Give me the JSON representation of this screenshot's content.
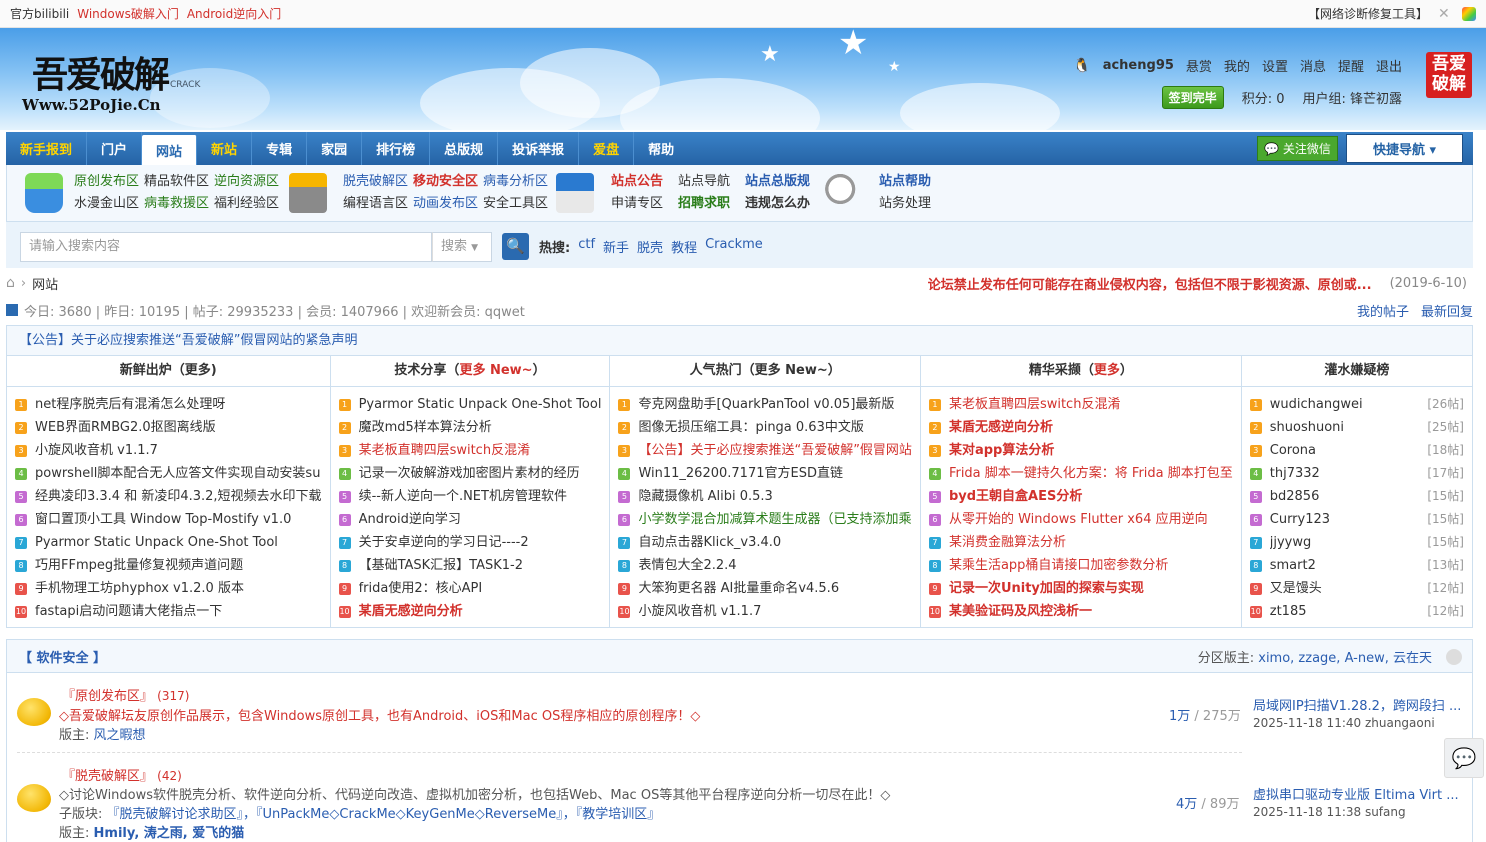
{
  "topbar": {
    "links": [
      "官方bilibili",
      "Windows破解入门",
      "Android逆向入门"
    ],
    "diag": "【网络诊断修复工具】"
  },
  "logo": {
    "big": "吾爱破解",
    "url": "Www.52PoJie.Cn",
    "crack": "CRACK"
  },
  "user": {
    "name": "acheng95",
    "menu": [
      "悬赏",
      "我的",
      "设置",
      "消息",
      "提醒",
      "退出"
    ],
    "checkin": "签到完毕",
    "points": "积分: 0",
    "group": "用户组: 锋芒初露",
    "badge": "吾爱破解"
  },
  "nav": {
    "items": [
      "新手报到",
      "门户",
      "网站",
      "新站",
      "专辑",
      "家园",
      "排行榜",
      "总版规",
      "投诉举报",
      "爱盘",
      "帮助"
    ],
    "wechat": "关注微信",
    "quick": "快捷导航 ▾"
  },
  "subnav": {
    "g1r1": [
      "原创发布区",
      "精品软件区",
      "逆向资源区"
    ],
    "g1r2": [
      "水漫金山区",
      "病毒救援区",
      "福利经验区"
    ],
    "g2r1": [
      "脱壳破解区",
      "移动安全区",
      "病毒分析区"
    ],
    "g2r2": [
      "编程语言区",
      "动画发布区",
      "安全工具区"
    ],
    "g3r1": [
      "站点公告",
      "站点导航",
      "站点总版规"
    ],
    "g3r2": [
      "申请专区",
      "招聘求职",
      "违规怎么办"
    ],
    "g4r1": [
      "站点帮助"
    ],
    "g4r2": [
      "站务处理"
    ]
  },
  "search": {
    "placeholder": "请输入搜索内容",
    "select": "搜索",
    "hot_label": "热搜:",
    "hot": [
      "ctf",
      "新手",
      "脱壳",
      "教程",
      "Crackme"
    ]
  },
  "crumb": {
    "here": "网站",
    "notice": "论坛禁止发布任何可能存在商业侵权内容，包括但不限于影视资源、原创或...",
    "date": "(2019-6-10)"
  },
  "stats": {
    "text": "今日: 3680 | 昨日: 10195 | 帖子: 29935233 | 会员: 1407966 | 欢迎新会员: qqwet",
    "links": [
      "我的帖子",
      "最新回复"
    ]
  },
  "announcement": "【公告】关于必应搜索推送“吾爱破解”假冒网站的紧急声明",
  "columns": [
    {
      "head": "新鲜出炉（更多)",
      "items": [
        "net程序脱壳后有混淆怎么处理呀",
        "WEB界面RMBG2.0抠图离线版",
        "小旋风收音机 v1.1.7",
        "powrshell脚本配合无人应答文件实现自动安装su",
        "经典凌印3.3.4 和 新凌印4.3.2,短视频去水印下载",
        "窗口置顶小工具 Window Top-Mostify v1.0",
        "Pyarmor Static Unpack One-Shot Tool",
        "巧用FFmpeg批量修复视频声道问题",
        "手机物理工坊phyphox v1.2.0 版本",
        "fastapi启动问题请大佬指点一下"
      ]
    },
    {
      "head": "技术分享（",
      "head_red": "更多 New~",
      "head_end": "）",
      "items": [
        "Pyarmor Static Unpack One-Shot Tool",
        "魔改md5样本算法分析",
        "某老板直聘四层switch反混淆",
        "记录一次破解游戏加密图片素材的经历",
        "续--新人逆向一个.NET机房管理软件",
        "Android逆向学习",
        "关于安卓逆向的学习日记----2",
        "【基础TASK汇报】TASK1-2",
        "frida使用2：核心API",
        "某盾无感逆向分析"
      ]
    },
    {
      "head": "人气热门（更多 New~）",
      "items": [
        "夸克网盘助手[QuarkPanTool v0.05]最新版",
        "图像无损压缩工具：pinga 0.63中文版",
        "【公告】关于必应搜索推送“吾爱破解”假冒网站",
        "Win11_26200.7171官方ESD直链",
        "隐藏摄像机 Alibi 0.5.3",
        "小学数学混合加减算术题生成器（已支持添加乘",
        "自动点击器Klick_v3.4.0",
        "表情包大全2.2.4",
        "大笨狗更名器 AI批量重命名v4.5.6",
        "小旋风收音机 v1.1.7"
      ]
    },
    {
      "head": "精华采撷（",
      "head_red": "更多",
      "head_end": "）",
      "items": [
        "某老板直聘四层switch反混淆",
        "某盾无感逆向分析",
        "某对app算法分析",
        "Frida 脚本一键持久化方案：将 Frida 脚本打包至",
        "byd王朝自盒AES分析",
        "从零开始的 Windows Flutter x64 应用逆向",
        "某消费金融算法分析",
        "某乘生活app桶自请接口加密参数分析",
        "记录一次Unity加固的探索与实现",
        "某美验证码及风控浅析一"
      ]
    },
    {
      "head": "灌水嫌疑榜",
      "items": [
        "wudichangwei",
        "shuoshuoni",
        "Corona",
        "thj7332",
        "bd2856",
        "Curry123",
        "jjyywg",
        "smart2",
        "又是馒头",
        "zt185"
      ],
      "counts": [
        "[26帖]",
        "[25帖]",
        "[18帖]",
        "[17帖]",
        "[15帖]",
        "[15帖]",
        "[15帖]",
        "[13帖]",
        "[12帖]",
        "[12帖]"
      ]
    }
  ],
  "section": {
    "title": "【 软件安全 】",
    "mods_label": "分区版主:",
    "mods": "ximo, zzage, A-new, 云在天",
    "forums": [
      {
        "name": "『原创发布区』",
        "count": "(317)",
        "desc": "◇吾爱破解坛友原创作品展示，包含Windows原创工具，也有Android、iOS和Mac OS程序相应的原创程序！◇",
        "mod_label": "版主:",
        "mods": "风之暇想",
        "stat_a": "1万",
        "stat_b": " / 275万",
        "last": "局域网IP扫描V1.28.2，跨网段扫 ...",
        "when": "2025-11-18 11:40 zhuangaoni"
      },
      {
        "name": "『脱壳破解区』",
        "count": "(42)",
        "desc": "◇讨论Windows软件脱壳分析、软件逆向分析、代码逆向改造、虚拟机加密分析，也包括Web、Mac OS等其他平台程序逆向分析一切尽在此！◇",
        "sub_label": "子版块:",
        "subs": "『脱壳破解讨论求助区』，『UnPackMe◇CrackMe◇KeyGenMe◇ReverseMe』，『教学培训区』",
        "mod_label": "版主:",
        "mods": "Hmily, 涛之雨, 爱飞的猫",
        "stat_a": "4万",
        "stat_b": " / 89万",
        "last": "虚拟串口驱动专业版 Eltima Virt ...",
        "when": "2025-11-18 11:38 sufang"
      }
    ]
  },
  "colors": {
    "nav": "#2563a5",
    "red": "#d2312c",
    "link": "#2a5db0",
    "green": "#2a7d1a"
  }
}
